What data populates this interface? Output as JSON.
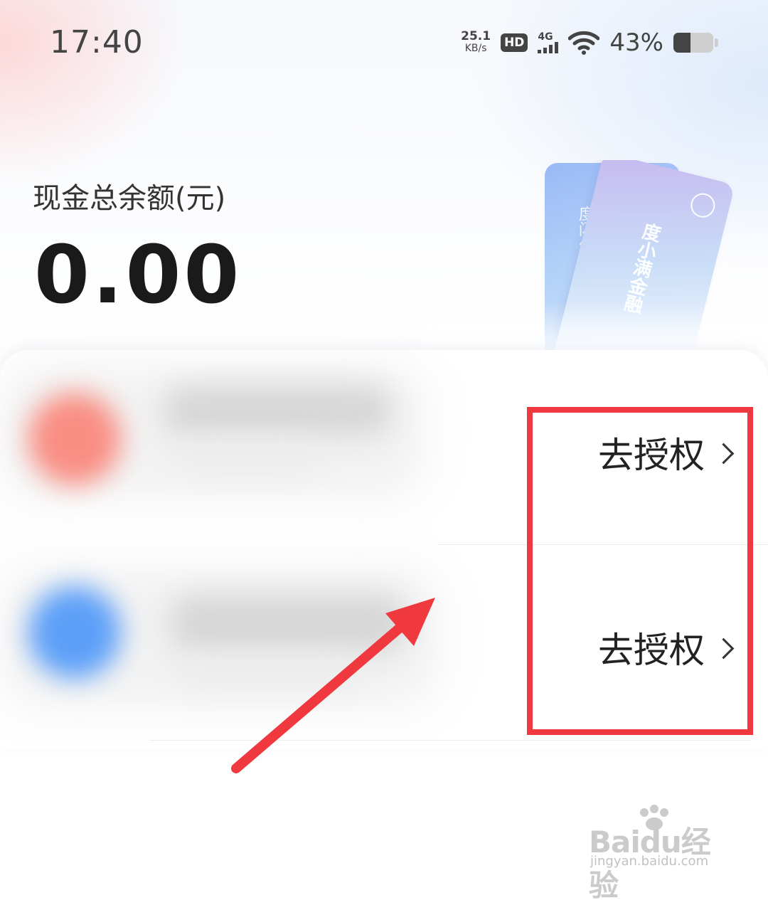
{
  "status_bar": {
    "time": "17:40",
    "net_speed_value": "25.1",
    "net_speed_unit": "KB/s",
    "hd_badge": "HD",
    "signal_label": "4G",
    "battery_percent": "43%",
    "battery_level": 0.43
  },
  "balance": {
    "label": "现金总余额(元)",
    "value": "0.00"
  },
  "cards_decoration": {
    "back_card_text": "度闪付余额",
    "front_card_text": "度小满金融"
  },
  "accounts": [
    {
      "action_label": "去授权"
    },
    {
      "action_label": "去授权"
    }
  ],
  "annotation": {
    "box_color": "#f0393e",
    "arrow_color": "#f0393e"
  },
  "watermark": {
    "logo_text": "Baidu经验",
    "url_text": "jingyan.baidu.com"
  },
  "icons": {
    "row_1_icon_color": "#f98d82",
    "row_2_icon_color": "#5c9ff8"
  }
}
